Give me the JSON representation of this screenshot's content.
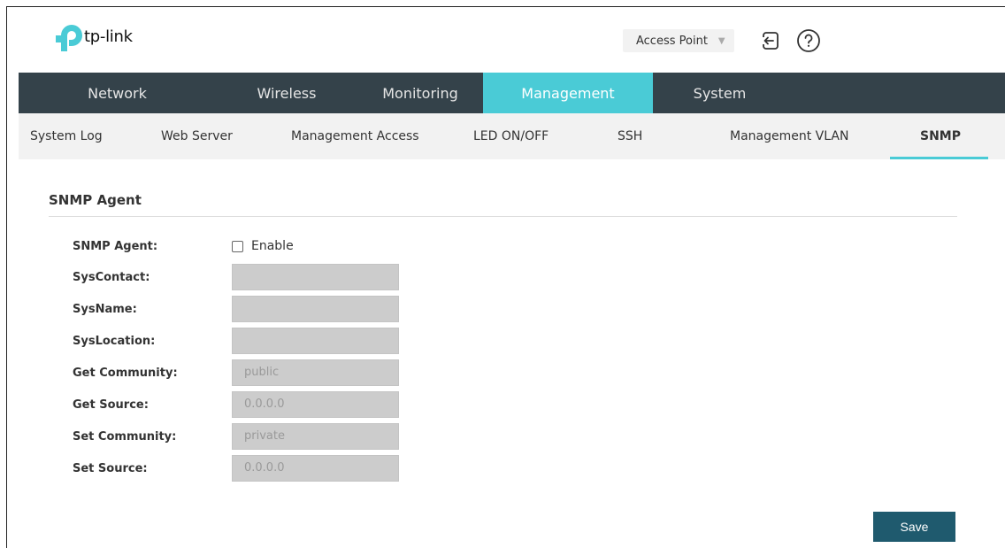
{
  "brand": {
    "logo_text": "tp-link",
    "accent_color": "#4acbd6",
    "nav_bg": "#34424a"
  },
  "header": {
    "mode_select": {
      "value": "Access Point"
    },
    "logout_icon": "logout-icon",
    "help_icon": "help-icon"
  },
  "main_nav": {
    "tabs": [
      {
        "label": "Network",
        "active": false
      },
      {
        "label": "Wireless",
        "active": false
      },
      {
        "label": "Monitoring",
        "active": false
      },
      {
        "label": "Management",
        "active": true
      },
      {
        "label": "System",
        "active": false
      }
    ]
  },
  "sub_nav": {
    "items": [
      {
        "label": "System Log",
        "active": false
      },
      {
        "label": "Web Server",
        "active": false
      },
      {
        "label": "Management Access",
        "active": false
      },
      {
        "label": "LED ON/OFF",
        "active": false
      },
      {
        "label": "SSH",
        "active": false
      },
      {
        "label": "Management VLAN",
        "active": false
      },
      {
        "label": "SNMP",
        "active": true
      }
    ]
  },
  "section": {
    "title": "SNMP Agent"
  },
  "form": {
    "snmp_agent": {
      "label": "SNMP Agent:",
      "checkbox_label": "Enable",
      "checked": false
    },
    "sys_contact": {
      "label": "SysContact:",
      "value": ""
    },
    "sys_name": {
      "label": "SysName:",
      "value": ""
    },
    "sys_location": {
      "label": "SysLocation:",
      "value": ""
    },
    "get_community": {
      "label": "Get Community:",
      "value": "public"
    },
    "get_source": {
      "label": "Get Source:",
      "value": "0.0.0.0"
    },
    "set_community": {
      "label": "Set Community:",
      "value": "private"
    },
    "set_source": {
      "label": "Set Source:",
      "value": "0.0.0.0"
    }
  },
  "actions": {
    "save_label": "Save"
  }
}
